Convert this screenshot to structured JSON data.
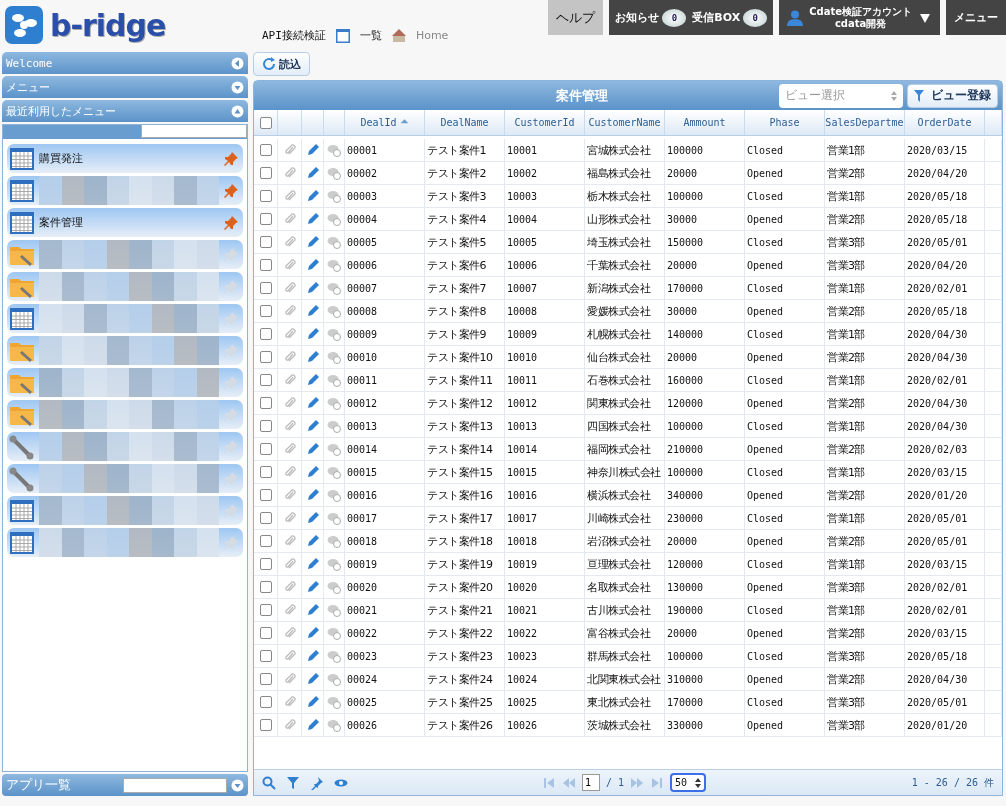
{
  "header": {
    "logo": "b-ridge",
    "breadcrumbs": [
      {
        "kind": "text",
        "label": "API接続検証"
      },
      {
        "kind": "grid",
        "label": "一覧"
      },
      {
        "kind": "home",
        "label": "Home"
      }
    ],
    "help": "ヘルプ",
    "notices": [
      {
        "label": "お知らせ",
        "count": "0"
      },
      {
        "label": "受信BOX",
        "count": "0"
      }
    ],
    "account": {
      "name": "Cdate検証アカウント",
      "org": "cdata開発"
    },
    "menu": "メニュー"
  },
  "sidebar": {
    "panels": [
      {
        "title": "Welcome",
        "expanded": false,
        "kind": "side"
      },
      {
        "title": "メニュー",
        "expanded": false
      },
      {
        "title": "最近利用したメニュー",
        "expanded": true
      }
    ],
    "items": [
      {
        "kind": "grid",
        "label": "購買発注",
        "pinned": true
      },
      {
        "kind": "grid",
        "blurred": true,
        "pinned": true
      },
      {
        "kind": "grid",
        "label": "案件管理",
        "pinned": true
      },
      {
        "kind": "folder",
        "blurred": true,
        "pinned": false
      },
      {
        "kind": "folder",
        "blurred": true,
        "pinned": false
      },
      {
        "kind": "grid",
        "blurred": true,
        "pinned": false
      },
      {
        "kind": "folder",
        "blurred": true,
        "pinned": false
      },
      {
        "kind": "folder",
        "blurred": true,
        "pinned": false
      },
      {
        "kind": "folder",
        "blurred": true,
        "pinned": false
      },
      {
        "kind": "wrench",
        "blurred": true,
        "pinned": false
      },
      {
        "kind": "wrench",
        "blurred": true,
        "pinned": false
      },
      {
        "kind": "grid",
        "blurred": true,
        "pinned": false
      },
      {
        "kind": "grid",
        "blurred": true,
        "pinned": false
      }
    ],
    "apps": {
      "title": "アプリ一覧"
    }
  },
  "toolbar": {
    "reload": "読込"
  },
  "grid": {
    "title": "案件管理",
    "all_checked": false,
    "view_select": {
      "placeholder": "ビュー選択"
    },
    "view_register": "ビュー登録",
    "columns": [
      {
        "label": "DealId",
        "sorted": true
      },
      {
        "label": "DealName",
        "sorted": false
      },
      {
        "label": "CustomerId",
        "sorted": false
      },
      {
        "label": "CustomerName",
        "sorted": false
      },
      {
        "label": "Ammount",
        "sorted": false
      },
      {
        "label": "Phase",
        "sorted": false
      },
      {
        "label": "SalesDepartme",
        "sorted": false
      },
      {
        "label": "OrderDate",
        "sorted": false
      }
    ],
    "rows": [
      {
        "checked": false,
        "cells": [
          "00001",
          "テスト案件1",
          "10001",
          "宮城株式会社",
          "100000",
          "Closed",
          "営業1部",
          "2020/03/15"
        ]
      },
      {
        "checked": false,
        "cells": [
          "00002",
          "テスト案件2",
          "10002",
          "福島株式会社",
          "20000",
          "Opened",
          "営業2部",
          "2020/04/20"
        ]
      },
      {
        "checked": false,
        "cells": [
          "00003",
          "テスト案件3",
          "10003",
          "栃木株式会社",
          "100000",
          "Closed",
          "営業1部",
          "2020/05/18"
        ]
      },
      {
        "checked": false,
        "cells": [
          "00004",
          "テスト案件4",
          "10004",
          "山形株式会社",
          "30000",
          "Opened",
          "営業2部",
          "2020/05/18"
        ]
      },
      {
        "checked": false,
        "cells": [
          "00005",
          "テスト案件5",
          "10005",
          "埼玉株式会社",
          "150000",
          "Closed",
          "営業3部",
          "2020/05/01"
        ]
      },
      {
        "checked": false,
        "cells": [
          "00006",
          "テスト案件6",
          "10006",
          "千葉株式会社",
          "20000",
          "Opened",
          "営業3部",
          "2020/04/20"
        ]
      },
      {
        "checked": false,
        "cells": [
          "00007",
          "テスト案件7",
          "10007",
          "新潟株式会社",
          "170000",
          "Closed",
          "営業1部",
          "2020/02/01"
        ]
      },
      {
        "checked": false,
        "cells": [
          "00008",
          "テスト案件8",
          "10008",
          "愛媛株式会社",
          "30000",
          "Opened",
          "営業2部",
          "2020/05/18"
        ]
      },
      {
        "checked": false,
        "cells": [
          "00009",
          "テスト案件9",
          "10009",
          "札幌株式会社",
          "140000",
          "Closed",
          "営業1部",
          "2020/04/30"
        ]
      },
      {
        "checked": false,
        "cells": [
          "00010",
          "テスト案件10",
          "10010",
          "仙台株式会社",
          "20000",
          "Opened",
          "営業2部",
          "2020/04/30"
        ]
      },
      {
        "checked": false,
        "cells": [
          "00011",
          "テスト案件11",
          "10011",
          "石巻株式会社",
          "160000",
          "Closed",
          "営業1部",
          "2020/02/01"
        ]
      },
      {
        "checked": false,
        "cells": [
          "00012",
          "テスト案件12",
          "10012",
          "関東株式会社",
          "120000",
          "Opened",
          "営業2部",
          "2020/04/30"
        ]
      },
      {
        "checked": false,
        "cells": [
          "00013",
          "テスト案件13",
          "10013",
          "四国株式会社",
          "100000",
          "Closed",
          "営業1部",
          "2020/04/30"
        ]
      },
      {
        "checked": false,
        "cells": [
          "00014",
          "テスト案件14",
          "10014",
          "福岡株式会社",
          "210000",
          "Opened",
          "営業2部",
          "2020/02/03"
        ]
      },
      {
        "checked": false,
        "cells": [
          "00015",
          "テスト案件15",
          "10015",
          "神奈川株式会社",
          "100000",
          "Closed",
          "営業1部",
          "2020/03/15"
        ]
      },
      {
        "checked": false,
        "cells": [
          "00016",
          "テスト案件16",
          "10016",
          "横浜株式会社",
          "340000",
          "Opened",
          "営業2部",
          "2020/01/20"
        ]
      },
      {
        "checked": false,
        "cells": [
          "00017",
          "テスト案件17",
          "10017",
          "川崎株式会社",
          "230000",
          "Closed",
          "営業1部",
          "2020/05/01"
        ]
      },
      {
        "checked": false,
        "cells": [
          "00018",
          "テスト案件18",
          "10018",
          "岩沼株式会社",
          "20000",
          "Opened",
          "営業2部",
          "2020/05/01"
        ]
      },
      {
        "checked": false,
        "cells": [
          "00019",
          "テスト案件19",
          "10019",
          "亘理株式会社",
          "120000",
          "Closed",
          "営業1部",
          "2020/03/15"
        ]
      },
      {
        "checked": false,
        "cells": [
          "00020",
          "テスト案件20",
          "10020",
          "名取株式会社",
          "130000",
          "Opened",
          "営業3部",
          "2020/02/01"
        ]
      },
      {
        "checked": false,
        "cells": [
          "00021",
          "テスト案件21",
          "10021",
          "古川株式会社",
          "190000",
          "Closed",
          "営業1部",
          "2020/02/01"
        ]
      },
      {
        "checked": false,
        "cells": [
          "00022",
          "テスト案件22",
          "10022",
          "富谷株式会社",
          "20000",
          "Opened",
          "営業2部",
          "2020/03/15"
        ]
      },
      {
        "checked": false,
        "cells": [
          "00023",
          "テスト案件23",
          "10023",
          "群馬株式会社",
          "100000",
          "Closed",
          "営業3部",
          "2020/05/18"
        ]
      },
      {
        "checked": false,
        "cells": [
          "00024",
          "テスト案件24",
          "10024",
          "北関東株式会社",
          "310000",
          "Opened",
          "営業2部",
          "2020/04/30"
        ]
      },
      {
        "checked": false,
        "cells": [
          "00025",
          "テスト案件25",
          "10025",
          "東北株式会社",
          "170000",
          "Closed",
          "営業3部",
          "2020/05/01"
        ]
      },
      {
        "checked": false,
        "cells": [
          "00026",
          "テスト案件26",
          "10026",
          "茨城株式会社",
          "330000",
          "Opened",
          "営業3部",
          "2020/01/20"
        ]
      }
    ],
    "pager": {
      "page": "1",
      "total_pages": "/ 1",
      "page_size": "50",
      "summary": "1 - 26 / 26 件"
    }
  }
}
